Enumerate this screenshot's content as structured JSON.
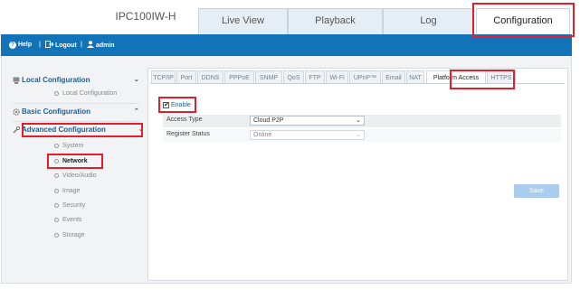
{
  "device_name": "IPC100IW-H",
  "main_tabs": [
    {
      "label": "Live View"
    },
    {
      "label": "Playback"
    },
    {
      "label": "Log"
    },
    {
      "label": "Configuration"
    }
  ],
  "toolbar": {
    "help": "Help",
    "logout": "Logout",
    "user": "admin",
    "separator": "|"
  },
  "sidebar": {
    "sections": [
      {
        "label": "Local Configuration",
        "icon": "computer-icon",
        "chevron": "⌄"
      },
      {
        "label": "Basic Configuration",
        "icon": "gear-icon",
        "chevron": "⌃"
      },
      {
        "label": "Advanced Configuration",
        "icon": "wrench-icon",
        "chevron": "⌄"
      }
    ],
    "local_items": [
      "Local Configuration"
    ],
    "advanced_items": [
      "System",
      "Network",
      "Video/Audio",
      "Image",
      "Security",
      "Events",
      "Storage"
    ],
    "active_item": "Network"
  },
  "subtabs": [
    "TCP/IP",
    "Port",
    "DDNS",
    "PPPoE",
    "SNMP",
    "QoS",
    "FTP",
    "Wi-Fi",
    "UPnP™",
    "Email",
    "NAT",
    "Platform Access",
    "HTTPS"
  ],
  "active_subtab": "Platform Access",
  "form": {
    "enable_label": "Enable",
    "enable_checked": true,
    "check_mark": "✔",
    "access_type_label": "Access Type",
    "access_type_value": "Cloud P2P",
    "register_status_label": "Register Status",
    "register_status_value": "Online",
    "dropdown_arrow": "⌄"
  },
  "save_label": "Save",
  "colors": {
    "brand_blue": "#1273b9",
    "annotation_red": "#e41d2b",
    "save_button": "#a8cdee"
  }
}
